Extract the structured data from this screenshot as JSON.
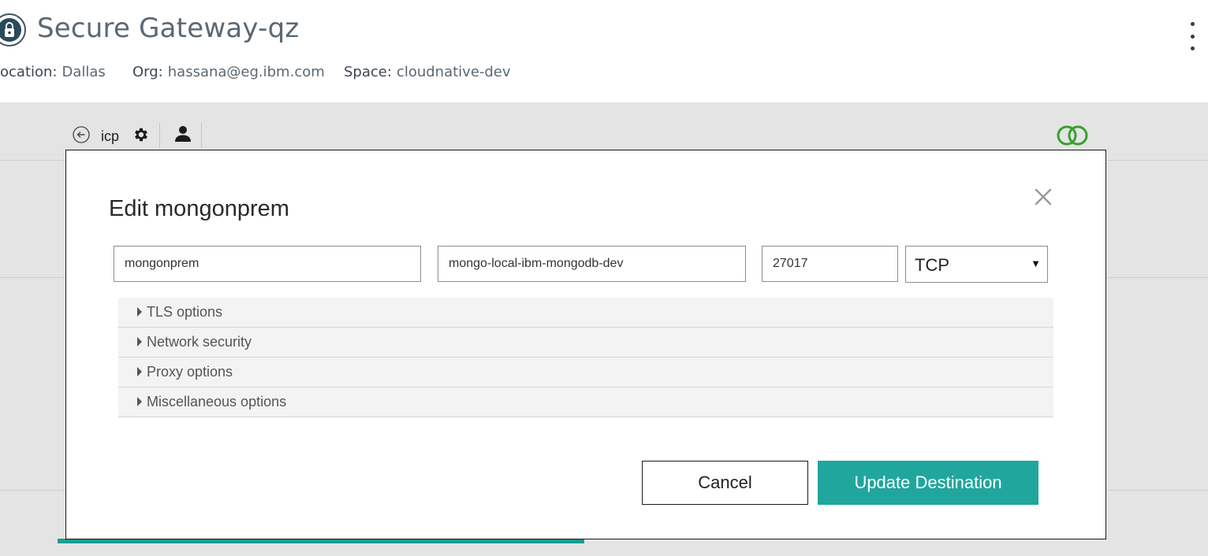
{
  "header": {
    "title": "Secure Gateway-qz",
    "location_label": "ocation:",
    "location_value": "Dallas",
    "org_label": "Org:",
    "org_value": "hassana@eg.ibm.com",
    "space_label": "Space:",
    "space_value": "cloudnative-dev",
    "logo_icon": "secure-gateway-logo-icon",
    "menu_icon": "kebab-menu-icon"
  },
  "toolbar": {
    "gateway_name": "icp",
    "back_icon": "back-arrow-icon",
    "settings_icon": "gear-icon",
    "user_icon": "user-icon",
    "status_icon": "connected-rings-icon",
    "status_color": "#3aa02c"
  },
  "modal": {
    "title": "Edit mongonprem",
    "close_icon": "close-icon",
    "fields": {
      "name": "mongonprem",
      "host": "mongo-local-ibm-mongodb-dev",
      "port": "27017",
      "protocol": "TCP"
    },
    "sections": [
      {
        "label": "TLS options"
      },
      {
        "label": "Network security"
      },
      {
        "label": "Proxy options"
      },
      {
        "label": "Miscellaneous options"
      }
    ],
    "cancel_label": "Cancel",
    "submit_label": "Update Destination",
    "accent_color": "#20a69d"
  }
}
